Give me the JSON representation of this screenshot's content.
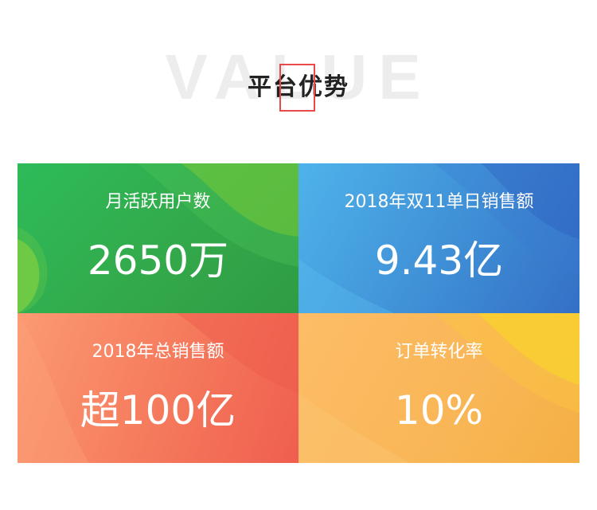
{
  "header": {
    "background_word": "VALUE",
    "title": "平台优势"
  },
  "cards": [
    {
      "label": "月活跃用户数",
      "value": "2650万",
      "color": "#33a84a"
    },
    {
      "label": "2018年双11单日销售额",
      "value": "9.43亿",
      "color": "#3f8fd6"
    },
    {
      "label": "2018年总销售额",
      "value": "超100亿",
      "color": "#f5795c"
    },
    {
      "label": "订单转化率",
      "value": "10%",
      "color": "#f9b656"
    }
  ],
  "colors": {
    "title_highlight_box": "#e84a4a",
    "background_word": "#ededed"
  }
}
